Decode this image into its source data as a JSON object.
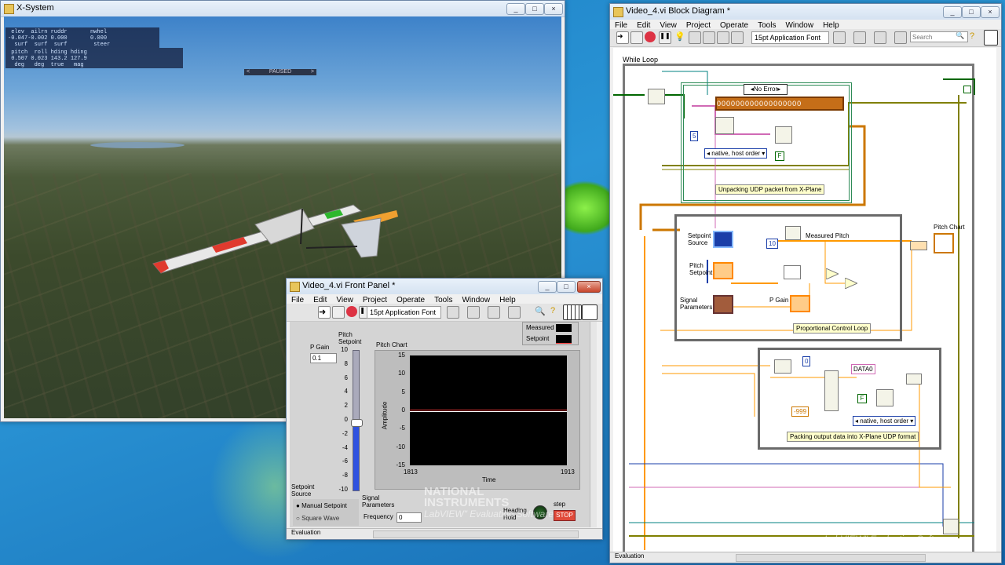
{
  "xsystem": {
    "title": "X-System",
    "hud_row1": " elev  ailrn ruddr       nwhel\n-0.047-0.002 0.000       0.000\n  surf  surf  surf        steer",
    "hud_row2": " pitch  roll hding hding\n 0.507 0.023 143.2 127.9\n  deg   deg  true   mag",
    "paused_label": "PAUSED",
    "paused_left": "<",
    "paused_right": ">"
  },
  "front_panel": {
    "title": "Video_4.vi Front Panel *",
    "menu": [
      "File",
      "Edit",
      "View",
      "Project",
      "Operate",
      "Tools",
      "Window",
      "Help"
    ],
    "font_selector": "15pt Application Font",
    "p_gain_label": "P Gain",
    "p_gain_value": "0.1",
    "pitch_setpoint_label": "Pitch Setpoint",
    "slider_ticks": [
      "10",
      "8",
      "6",
      "4",
      "2",
      "0",
      "-2",
      "-4",
      "-6",
      "-8",
      "-10"
    ],
    "slider_value": -0.5,
    "chart_title": "Pitch Chart",
    "legend": [
      "Measured",
      "Setpoint"
    ],
    "y_axis_label": "Amplitude",
    "x_axis_label": "Time",
    "y_ticks": [
      "15",
      "10",
      "5",
      "0",
      "-5",
      "-10",
      "-15"
    ],
    "x_min": "1813",
    "x_max": "1913",
    "setpoint_source_label": "Setpoint Source",
    "radio_options": [
      "Manual Setpoint",
      "Square Wave"
    ],
    "signal_params_label": "Signal Parameters",
    "frequency_label": "Frequency",
    "frequency_value": "0",
    "heading_hold_label": "Heading Hold",
    "step_label": "step",
    "stop_label": "STOP",
    "status": "Evaluation"
  },
  "block_diagram": {
    "title": "Video_4.vi Block Diagram *",
    "menu": [
      "File",
      "Edit",
      "View",
      "Project",
      "Operate",
      "Tools",
      "Window",
      "Help"
    ],
    "font_selector": "15pt Application Font",
    "search_placeholder": "Search",
    "while_loop_label": "While Loop",
    "case_selector": "No Error",
    "bool_array": "000000000000000000",
    "num_const_5": "5",
    "num_const_10": "10",
    "num_const_0": "0",
    "num_const_neg999": "-999",
    "byte_order_1": "native, host order",
    "byte_order_2": "native, host order",
    "false_const": "F",
    "caption_unpack": "Unpacking UDP packet from X-Plane",
    "setpoint_source_label": "Setpoint Source",
    "pitch_setpoint_label": "Pitch Setpoint",
    "signal_params_label": "Signal Parameters",
    "p_gain_label": "P Gain",
    "measured_pitch_label": "Measured Pitch",
    "pitch_chart_label": "Pitch Chart",
    "caption_pcl": "Proportional Control Loop",
    "data_string": "DATA0",
    "caption_pack": "Packing output data into X-Plane UDP format",
    "status": "Evaluation"
  },
  "watermark": {
    "line1": "NATIONAL",
    "line2": "INSTRUMENTS",
    "line3": "LabVIEW\" Evaluation Software"
  },
  "colors": {
    "desktop": "#1d7fc4",
    "wire_orange": "#ff9900",
    "wire_pink": "#d06ab5",
    "wire_blue": "#1a3ea8",
    "wire_olive": "#808000",
    "wire_green": "#006600",
    "stop_button": "#e04a3a"
  }
}
